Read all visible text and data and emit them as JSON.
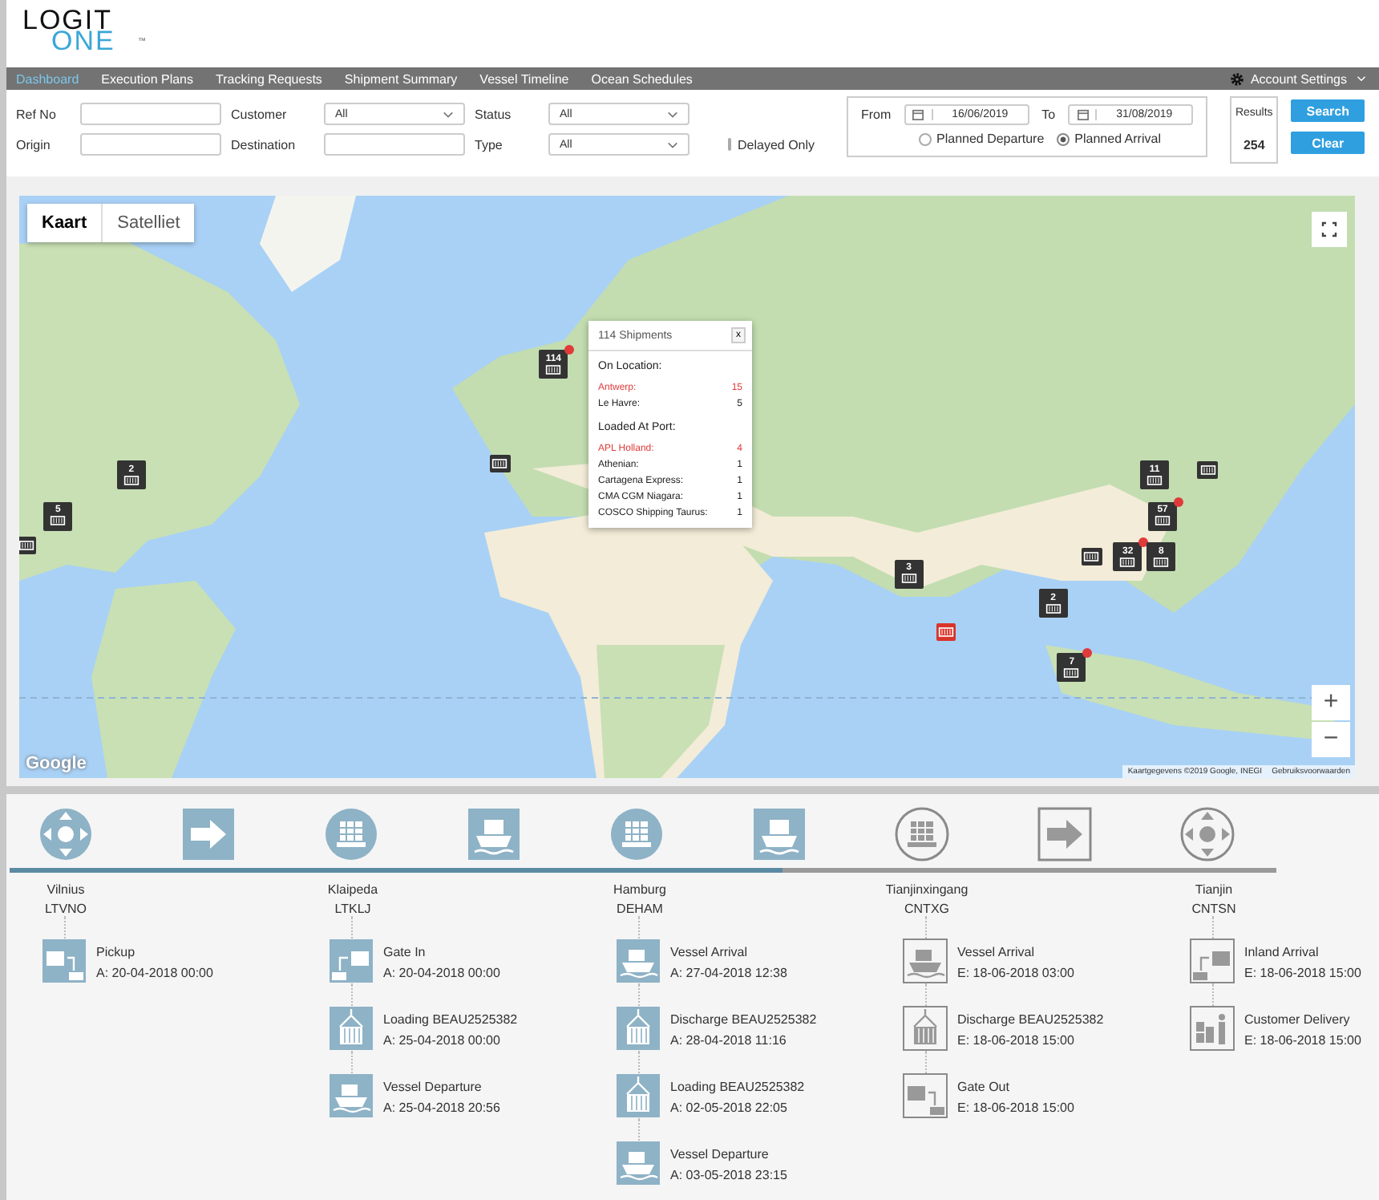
{
  "logo": {
    "part_1": "LOGIT",
    "part_2": "ONE",
    "trademark": "™"
  },
  "nav": {
    "tabs": [
      {
        "label": "Dashboard",
        "selected": true
      },
      {
        "label": "Execution Plans",
        "selected": false
      },
      {
        "label": "Tracking Requests",
        "selected": false
      },
      {
        "label": "Shipment Summary",
        "selected": false
      },
      {
        "label": "Vessel Timeline",
        "selected": false
      },
      {
        "label": "Ocean Schedules",
        "selected": false
      }
    ],
    "account": "Account Settings"
  },
  "filters": {
    "ref_no": {
      "label": "Ref No"
    },
    "origin": {
      "label": "Origin"
    },
    "customer": {
      "label": "Customer",
      "value": "All"
    },
    "destination": {
      "label": "Destination"
    },
    "status": {
      "label": "Status",
      "value": "All"
    },
    "type": {
      "label": "Type",
      "value": "All"
    },
    "delayed_only": {
      "label": "Delayed Only",
      "checked": false
    },
    "from": {
      "label": "From",
      "value": "16/06/2019"
    },
    "to": {
      "label": "To",
      "value": "31/08/2019"
    },
    "date_mode": [
      {
        "label": "Planned Departure",
        "selected": false
      },
      {
        "label": "Planned Arrival",
        "selected": true
      }
    ],
    "results": {
      "label": "Results",
      "value": "254"
    },
    "buttons": [
      "Search",
      "Clear"
    ]
  },
  "map": {
    "map_types": [
      {
        "label": "Kaart",
        "selected": true
      },
      {
        "label": "Satelliet",
        "selected": false
      }
    ],
    "markers": [
      {
        "kind": "count",
        "count": "114",
        "alert": true
      },
      {
        "kind": "count",
        "count": "2",
        "alert": false
      },
      {
        "kind": "count",
        "count": "5",
        "alert": false
      },
      {
        "kind": "plain",
        "alert": false
      },
      {
        "kind": "plain",
        "alert": false
      },
      {
        "kind": "count",
        "count": "3",
        "alert": false
      },
      {
        "kind": "red",
        "alert": false
      },
      {
        "kind": "count",
        "count": "2",
        "alert": false
      },
      {
        "kind": "count",
        "count": "11",
        "alert": false
      },
      {
        "kind": "plain",
        "alert": false
      },
      {
        "kind": "count",
        "count": "57",
        "alert": true
      },
      {
        "kind": "plain",
        "alert": false
      },
      {
        "kind": "count",
        "count": "32",
        "alert": true
      },
      {
        "kind": "count",
        "count": "8",
        "alert": false
      },
      {
        "kind": "count",
        "count": "7",
        "alert": true
      }
    ],
    "popup": {
      "title": "114 Shipments",
      "close": "x",
      "sections": [
        {
          "heading": "On Location:",
          "rows": [
            {
              "name": "Antwerp:",
              "count": "15",
              "alert": true
            },
            {
              "name": "Le Havre:",
              "count": "5",
              "alert": false
            }
          ]
        },
        {
          "heading": "Loaded At Port:",
          "rows": [
            {
              "name": "APL Holland:",
              "count": "4",
              "alert": true
            },
            {
              "name": "Athenian:",
              "count": "1",
              "alert": false
            },
            {
              "name": "Cartagena Express:",
              "count": "1",
              "alert": false
            },
            {
              "name": "CMA CGM Niagara:",
              "count": "1",
              "alert": false
            },
            {
              "name": "COSCO Shipping Taurus:",
              "count": "1",
              "alert": false
            }
          ]
        }
      ]
    },
    "google": "Google",
    "attribution": "Kaartgegevens ©2019 Google, INEGI",
    "terms": "Gebruiksvoorwaarden",
    "zoom_in": "+",
    "zoom_out": "−"
  },
  "timeline": {
    "level": 0.61,
    "stops": [
      {
        "kind": "hub",
        "completed": true
      },
      {
        "kind": "arrow",
        "completed": true
      },
      {
        "kind": "port",
        "completed": true
      },
      {
        "kind": "vessel",
        "completed": true
      },
      {
        "kind": "port",
        "completed": true
      },
      {
        "kind": "vessel",
        "completed": true
      },
      {
        "kind": "port",
        "completed": false
      },
      {
        "kind": "arrow",
        "completed": false
      },
      {
        "kind": "hub",
        "completed": false
      }
    ],
    "locations": [
      {
        "name": "Vilnius",
        "code": "LTVNO",
        "events": [
          {
            "kind": "pickup",
            "completed": true,
            "title": "Pickup",
            "date": "A: 20-04-2018 00:00"
          }
        ]
      },
      {
        "name": "Klaipeda",
        "code": "LTKLJ",
        "events": [
          {
            "kind": "gate-in",
            "completed": true,
            "title": "Gate In",
            "date": "A: 20-04-2018 00:00"
          },
          {
            "kind": "crane",
            "completed": true,
            "title": "Loading BEAU2525382",
            "date": "A: 25-04-2018 00:00"
          },
          {
            "kind": "ship",
            "completed": true,
            "title": "Vessel Departure",
            "date": "A: 25-04-2018 20:56"
          }
        ]
      },
      {
        "name": "Hamburg",
        "code": "DEHAM",
        "events": [
          {
            "kind": "ship",
            "completed": true,
            "title": "Vessel Arrival",
            "date": "A: 27-04-2018 12:38"
          },
          {
            "kind": "crane",
            "completed": true,
            "title": "Discharge BEAU2525382",
            "date": "A: 28-04-2018 11:16"
          },
          {
            "kind": "crane",
            "completed": true,
            "title": "Loading BEAU2525382",
            "date": "A: 02-05-2018 22:05"
          },
          {
            "kind": "ship",
            "completed": true,
            "title": "Vessel Departure",
            "date": "A: 03-05-2018 23:15"
          }
        ]
      },
      {
        "name": "Tianjinxingang",
        "code": "CNTXG",
        "events": [
          {
            "kind": "ship",
            "completed": false,
            "title": "Vessel Arrival",
            "date": "E: 18-06-2018 03:00"
          },
          {
            "kind": "crane",
            "completed": false,
            "title": "Discharge BEAU2525382",
            "date": "E: 18-06-2018 15:00"
          },
          {
            "kind": "gate-out",
            "completed": false,
            "title": "Gate Out",
            "date": "E: 18-06-2018 15:00"
          }
        ]
      },
      {
        "name": "Tianjin",
        "code": "CNTSN",
        "events": [
          {
            "kind": "gate-in",
            "completed": false,
            "title": "Inland Arrival",
            "date": "E: 18-06-2018 15:00"
          },
          {
            "kind": "delivery",
            "completed": false,
            "title": "Customer Delivery",
            "date": "E: 18-06-2018 15:00"
          }
        ]
      }
    ]
  }
}
